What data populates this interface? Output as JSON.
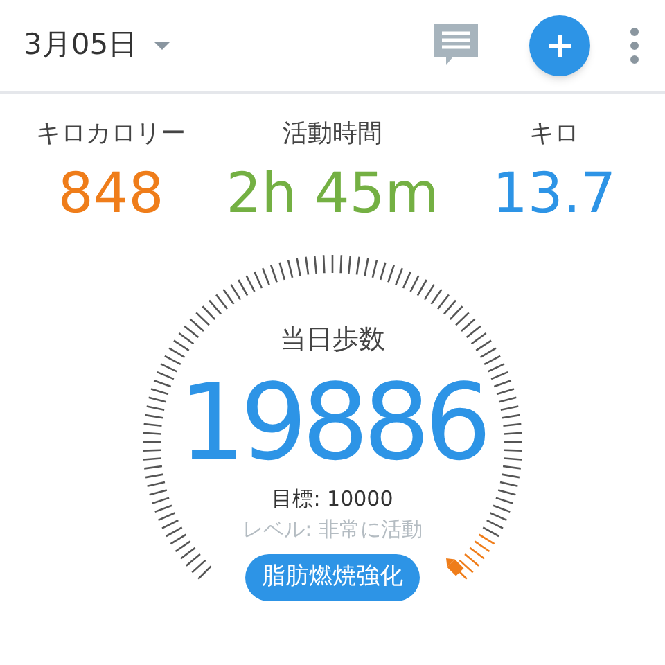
{
  "header": {
    "date": "3月05日"
  },
  "stats": [
    {
      "label": "キロカロリー",
      "value": "848",
      "color": "#ef7d1a"
    },
    {
      "label": "活動時間",
      "value": "2h 45m",
      "color": "#74b043"
    },
    {
      "label": "キロ",
      "value": "13.7",
      "color": "#2d94e6"
    }
  ],
  "gauge": {
    "title": "当日歩数",
    "steps": "19886",
    "goal": "目標: 10000",
    "activity": "レベル: 非常に活動",
    "badge": "脂肪燃焼強化"
  }
}
